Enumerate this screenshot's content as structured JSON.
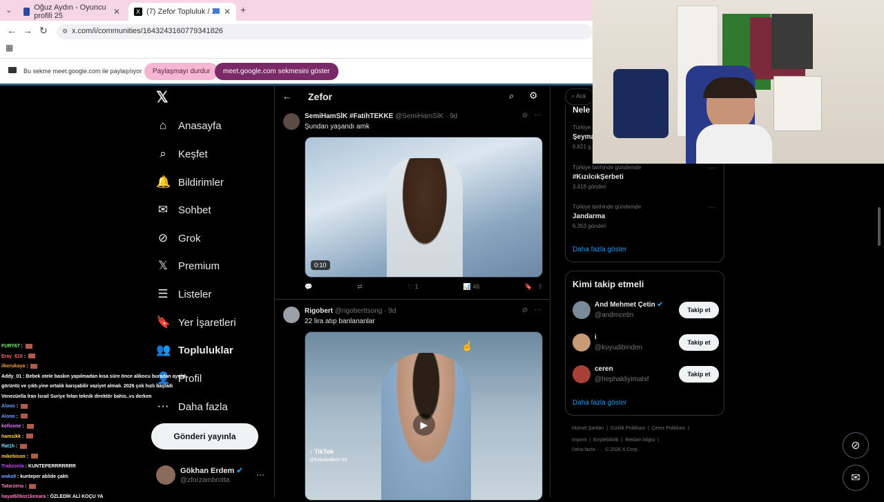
{
  "browser": {
    "tabs": [
      {
        "title": "Oğuz Aydın - Oyuncu profili 25",
        "close": "✕"
      },
      {
        "title": "(7) Zefor Topluluk / X",
        "close": "✕"
      }
    ],
    "new_tab": "+",
    "url": "x.com/i/communities/1643243160779341826",
    "share_info": "Bu sekme meet.google.com ile paylaşılıyor",
    "stop_sharing": "Paylaşmayı durdur",
    "show_tab": "meet.google.com sekmesini göster"
  },
  "sidebar": {
    "items": [
      {
        "label": "Anasayfa",
        "icon": "⌂"
      },
      {
        "label": "Keşfet",
        "icon": "⌕"
      },
      {
        "label": "Bildirimler",
        "icon": "🔔"
      },
      {
        "label": "Sohbet",
        "icon": "✉"
      },
      {
        "label": "Grok",
        "icon": "⊘"
      },
      {
        "label": "Premium",
        "icon": "𝕏"
      },
      {
        "label": "Listeler",
        "icon": "☰"
      },
      {
        "label": "Yer İşaretleri",
        "icon": "🔖"
      },
      {
        "label": "Topluluklar",
        "icon": "👥"
      },
      {
        "label": "Profil",
        "icon": "👤"
      },
      {
        "label": "Daha fazla",
        "icon": "⋯"
      }
    ],
    "post_button": "Gönderi yayınla",
    "account": {
      "name": "Gökhan Erdem",
      "handle": "@zforzambrotta"
    }
  },
  "feed": {
    "title": "Zefor",
    "tweets": [
      {
        "name": "SemiHamSİK #FatihTEKKE",
        "handle": "@SemiHamSİK · 9d",
        "text": "Şundan yaşandı amk",
        "video_time": "0:10",
        "likes": "1",
        "views": "46"
      },
      {
        "name": "Rigobert",
        "handle": "@rigobertt­song · 9d",
        "text": "22 lira atıp banlananlar",
        "watermark": "TikTok",
        "watermark_handle": "@futboledits9746"
      }
    ]
  },
  "right": {
    "search_placeholder": "Ara",
    "trends_partial": {
      "heading": "Nele",
      "c1": "Türkiye t",
      "t1": "Şeyma",
      "n1": "6.821 g"
    },
    "trends": [
      {
        "context": "Türkiye tarihinde gündemde",
        "topic": "#KızılcıkŞerbeti",
        "count": "3.418 gönderi"
      },
      {
        "context": "Türkiye tarihinde gündemde",
        "topic": "Jandarma",
        "count": "6.353 gönderi"
      }
    ],
    "show_more": "Daha fazla göster",
    "who_to_follow": "Kimi takip etmeli",
    "follow": [
      {
        "name": "And Mehmet Çetin",
        "handle": "@andmcetin",
        "button": "Takip et"
      },
      {
        "name": "i",
        "handle": "@kuyudibinden",
        "button": "Takip et"
      },
      {
        "name": "ceren",
        "handle": "@hephakliyimalsf",
        "button": "Takip et"
      }
    ],
    "footer": [
      "Hizmet Şartları",
      "Gizlilik Politikası",
      "Çerez Politikası",
      "Imprint",
      "Erişilebilirlik",
      "Reklam bilgisi",
      "Daha fazla ···",
      "© 2026 X Corp."
    ]
  },
  "chat": [
    {
      "user": "FURY67",
      "msg": "",
      "color": "#7cf07c"
    },
    {
      "user": "Eray_610",
      "msg": "",
      "color": "#ff6a6a"
    },
    {
      "user": "ilkerukaya",
      "msg": "",
      "color": "#ff9a3a"
    },
    {
      "user": "Addy_01",
      "msg": "Bebek otele baskın yapılmadan kısa süre önce alikocu buradan ayrıldı",
      "color": "#ffffff"
    },
    {
      "user": "",
      "msg": "görüntü ve çıktı.yine ortalık karışabilir vaziyet almalı. 2026 çok hızlı başladı",
      "color": "#ffffff"
    },
    {
      "user": "",
      "msg": "Venezüella İran İsrail Suriye felan teknik direktör bahis..vs derken",
      "color": "#ffffff"
    },
    {
      "user": "Alooo",
      "msg": "",
      "color": "#6aa0ff"
    },
    {
      "user": "Alooo",
      "msg": "",
      "color": "#6aa0ff"
    },
    {
      "user": "kofizone",
      "msg": "",
      "color": "#e07cff"
    },
    {
      "user": "hamsikk",
      "msg": "",
      "color": "#ffd24a"
    },
    {
      "user": "ffat1h",
      "msg": "",
      "color": "#7ce0ff"
    },
    {
      "user": "mikebison",
      "msg": "",
      "color": "#ffd24a"
    },
    {
      "user": "Trabzonla",
      "msg": "KUNTEPERRRRRRR",
      "color": "#c04aff"
    },
    {
      "user": "waka9",
      "msg": "kunteper ablide çaktı",
      "color": "#6aa0ff"
    },
    {
      "user": "Tatarzena",
      "msg": "",
      "color": "#ff7cc0"
    },
    {
      "user": "hayat60bizi1kenara",
      "msg": "ÖZLEDİK ALİ KOÇU YA",
      "color": "#ff7cc0"
    }
  ],
  "colors": {
    "accent": "#1d9bf0",
    "bg": "#000000",
    "verified": "#1d9bf0"
  }
}
